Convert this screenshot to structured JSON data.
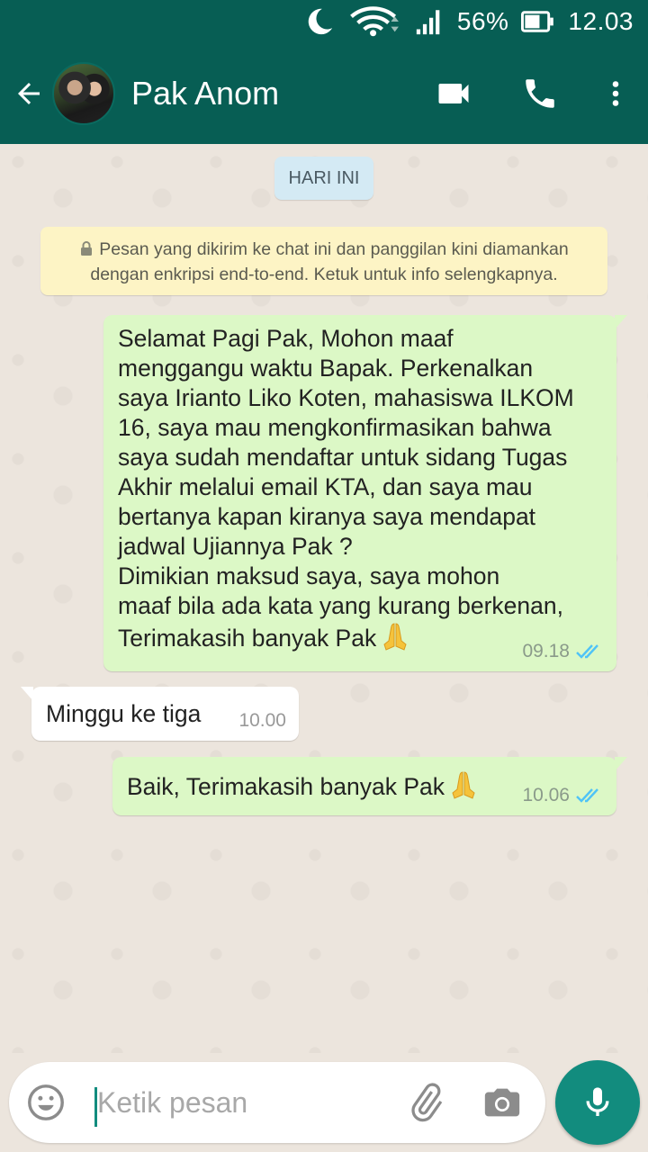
{
  "status_bar": {
    "battery": "56%",
    "time": "12.03"
  },
  "header": {
    "contact_name": "Pak Anom"
  },
  "chat": {
    "date_chip": "HARI INI",
    "encryption_notice": "Pesan yang dikirim ke chat ini dan panggilan kini diamankan dengan enkripsi end-to-end. Ketuk untuk info selengkapnya.",
    "messages": [
      {
        "direction": "outgoing",
        "lines": [
          "Selamat Pagi Pak, Mohon maaf",
          "menggangu waktu Bapak. Perkenalkan",
          "saya Irianto Liko Koten, mahasiswa ILKOM",
          "16, saya mau mengkonfirmasikan bahwa",
          "saya sudah mendaftar untuk sidang Tugas",
          "Akhir melalui email KTA, dan saya mau",
          "bertanya kapan kiranya saya mendapat",
          "jadwal Ujiannya Pak ?",
          "Dimikian maksud saya, saya mohon",
          "maaf bila ada kata yang kurang berkenan,",
          "Terimakasih banyak Pak"
        ],
        "emoji": "folded-hands",
        "time": "09.18",
        "status": "read"
      },
      {
        "direction": "incoming",
        "text": "Minggu ke tiga",
        "time": "10.00"
      },
      {
        "direction": "outgoing",
        "text": "Baik, Terimakasih banyak Pak",
        "emoji": "folded-hands",
        "time": "10.06",
        "status": "read"
      }
    ]
  },
  "composer": {
    "placeholder": "Ketik pesan",
    "value": ""
  },
  "colors": {
    "header": "#075e54",
    "outgoing_bubble": "#dcf8c6",
    "incoming_bubble": "#ffffff",
    "read_ticks": "#4fc3f7",
    "fab": "#128c7e",
    "notice_bg": "#fdf4c5"
  }
}
